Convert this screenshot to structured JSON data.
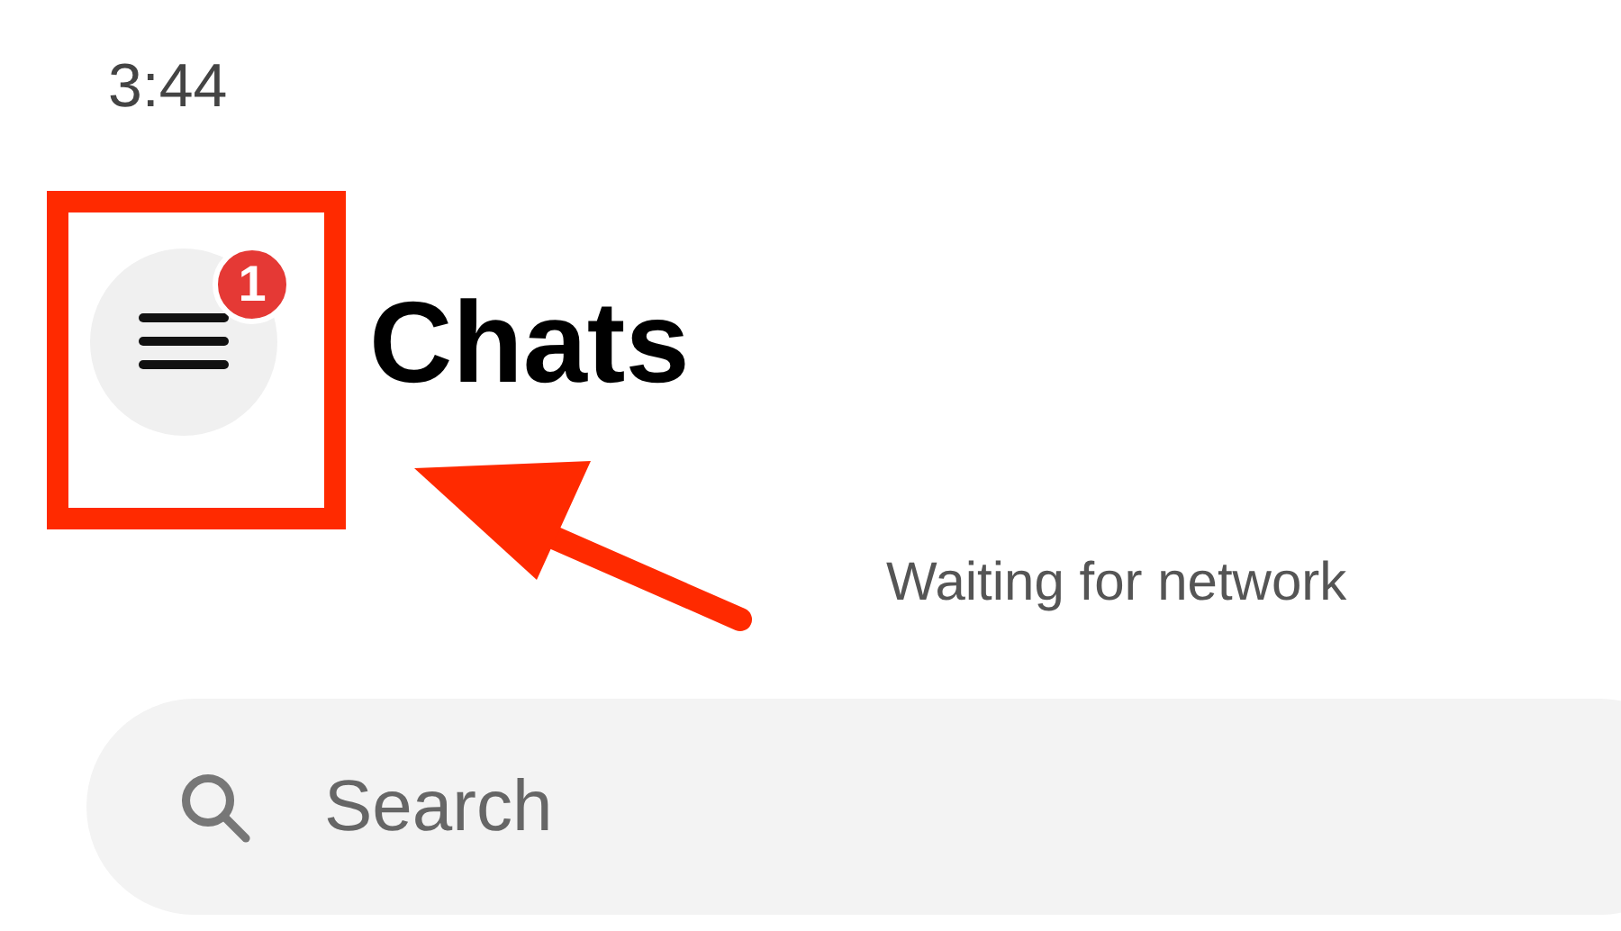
{
  "status_bar": {
    "time": "3:44"
  },
  "header": {
    "menu_badge": "1",
    "title": "Chats"
  },
  "connection_status": "Waiting for network",
  "search": {
    "placeholder": "Search"
  }
}
